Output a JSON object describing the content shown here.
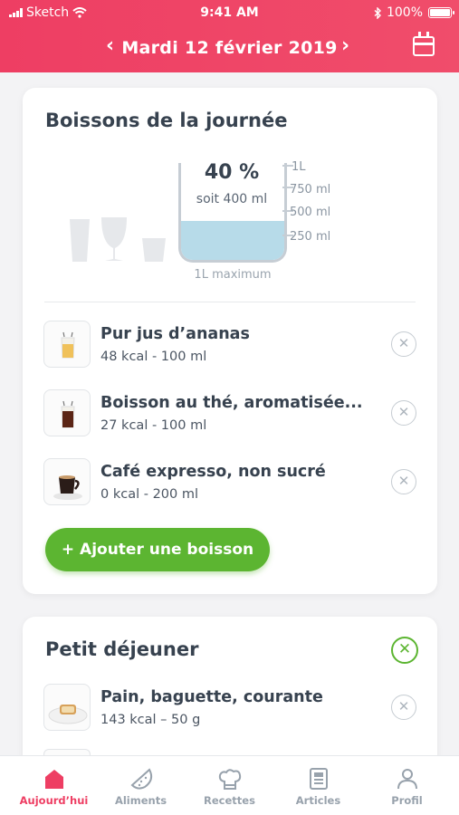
{
  "status_bar": {
    "carrier": "Sketch",
    "time": "9:41 AM",
    "battery": "100%",
    "battery_level": 1.0
  },
  "header": {
    "date": "Mardi 12 février 2019",
    "prev_icon": "chevron-left-icon",
    "next_icon": "chevron-right-icon",
    "calendar_icon": "calendar-icon"
  },
  "drinks": {
    "title": "Boissons de la journée",
    "percent": "40 %",
    "soit": "soit 400 ml",
    "fill_fraction": 0.4,
    "scale": [
      "1L",
      "750 ml",
      "500 ml",
      "250 ml"
    ],
    "max_label": "1L maximum",
    "items": [
      {
        "name": "Pur jus d’ananas",
        "sub": "48 kcal - 100 ml"
      },
      {
        "name": "Boisson au thé, aromatisée...",
        "sub": "27 kcal - 100 ml"
      },
      {
        "name": "Café expresso, non sucré",
        "sub": "0 kcal - 200 ml"
      }
    ],
    "add_button": "+ Ajouter une boisson"
  },
  "breakfast": {
    "title": "Petit déjeuner",
    "items": [
      {
        "name": "Pain, baguette, courante",
        "sub": "143 kcal – 50 g"
      }
    ]
  },
  "tabs": [
    {
      "label": "Aujourd’hui",
      "icon": "home-icon",
      "active": true
    },
    {
      "label": "Aliments",
      "icon": "watermelon-icon",
      "active": false
    },
    {
      "label": "Recettes",
      "icon": "chef-hat-icon",
      "active": false
    },
    {
      "label": "Articles",
      "icon": "article-icon",
      "active": false
    },
    {
      "label": "Profil",
      "icon": "person-icon",
      "active": false
    }
  ],
  "colors": {
    "brand": "#ee3e63",
    "accent_green": "#5cb531",
    "water": "#b7dbe9"
  }
}
